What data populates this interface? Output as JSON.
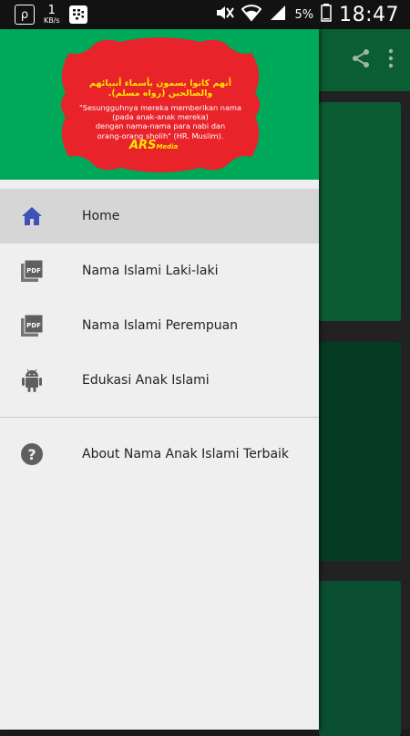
{
  "status_bar": {
    "speed_value": "1",
    "speed_unit": "KB/s",
    "battery_percent": "5%",
    "time": "18:47"
  },
  "drawer": {
    "header": {
      "arabic_text": "أنهم كانوا يسمون بأسماء أنبيائهم والصالحين (رواه مسلم).",
      "quote_lines": [
        "\"Sesungguhnya mereka memberikan nama",
        "(pada anak-anak mereka)",
        "dengan nama-nama para nabi dan",
        "orang-orang sholih\" (HR. Muslim)."
      ],
      "logo_main": "ARS",
      "logo_sub": "Media"
    },
    "items": [
      {
        "label": "Home",
        "icon": "home-icon",
        "active": true
      },
      {
        "label": "Nama Islami Laki-laki",
        "icon": "pdf-icon"
      },
      {
        "label": "Nama Islami Perempuan",
        "icon": "pdf-icon"
      },
      {
        "label": "Edukasi Anak Islami",
        "icon": "android-icon"
      },
      {
        "label": "About Nama Anak Islami Terbaik",
        "icon": "help-icon"
      }
    ]
  },
  "colors": {
    "header_green": "#00a85a",
    "badge_red": "#e8232a",
    "toolbar_green": "#0b5e33",
    "active_item": "#d6d6d6",
    "home_icon_blue": "#3f51b5"
  }
}
